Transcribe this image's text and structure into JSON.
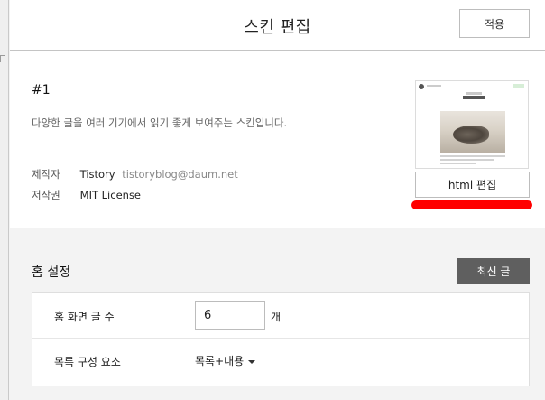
{
  "header": {
    "title": "스킨 편집",
    "apply_label": "적용"
  },
  "skin": {
    "number": "#1",
    "description": "다양한 글을 여러 기기에서 읽기 좋게 보여주는 스킨입니다.",
    "maker_label": "제작자",
    "maker_name": "Tistory",
    "maker_email": "tistoryblog@daum.net",
    "license_label": "저작권",
    "license_value": "MIT License",
    "html_edit_label": "html 편집",
    "highlight_color": "#ff0000"
  },
  "home": {
    "title": "홈 설정",
    "latest_label": "최신 글",
    "post_count_label": "홈 화면 글 수",
    "post_count_value": "6",
    "post_count_unit": "개",
    "list_label": "목록 구성 요소",
    "list_value": "목록+내용"
  },
  "colors": {
    "latest_button_bg": "#5f5f5f",
    "page_bg": "#f3f3f3"
  },
  "icons": [
    "chevron-down-icon"
  ]
}
